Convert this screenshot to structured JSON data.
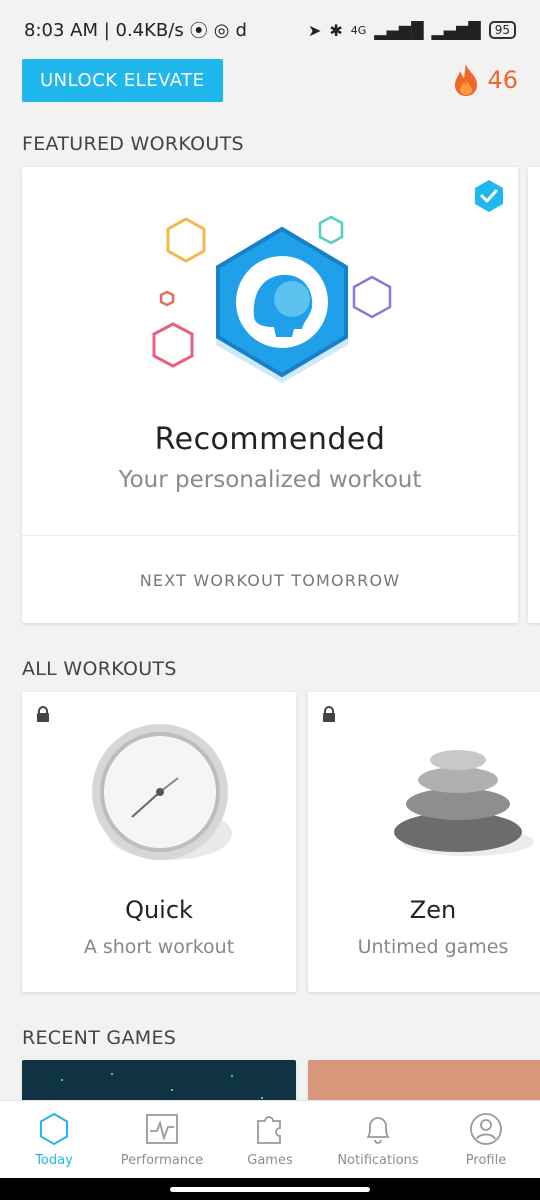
{
  "status_bar": {
    "time": "8:03 AM | 0.4KB/s",
    "right_text": "4G",
    "battery": "95"
  },
  "header": {
    "unlock_label": "UNLOCK ELEVATE",
    "streak_count": "46",
    "accent_color": "#1fb7ec",
    "streak_color": "#f0672c"
  },
  "featured": {
    "section_title": "FEATURED WORKOUTS",
    "title": "Recommended",
    "subtitle": "Your personalized workout",
    "next_label": "NEXT WORKOUT TOMORROW"
  },
  "all_workouts": {
    "section_title": "ALL WORKOUTS",
    "items": [
      {
        "title": "Quick",
        "subtitle": "A short workout",
        "icon": "stopwatch-icon"
      },
      {
        "title": "Zen",
        "subtitle": "Untimed games",
        "icon": "stones-icon"
      }
    ]
  },
  "recent_games": {
    "section_title": "RECENT GAMES"
  },
  "tabs": [
    {
      "label": "Today",
      "icon": "hexagon-icon",
      "active": true
    },
    {
      "label": "Performance",
      "icon": "chart-icon",
      "active": false
    },
    {
      "label": "Games",
      "icon": "puzzle-icon",
      "active": false
    },
    {
      "label": "Notifications",
      "icon": "bell-icon",
      "active": false
    },
    {
      "label": "Profile",
      "icon": "profile-icon",
      "active": false
    }
  ]
}
